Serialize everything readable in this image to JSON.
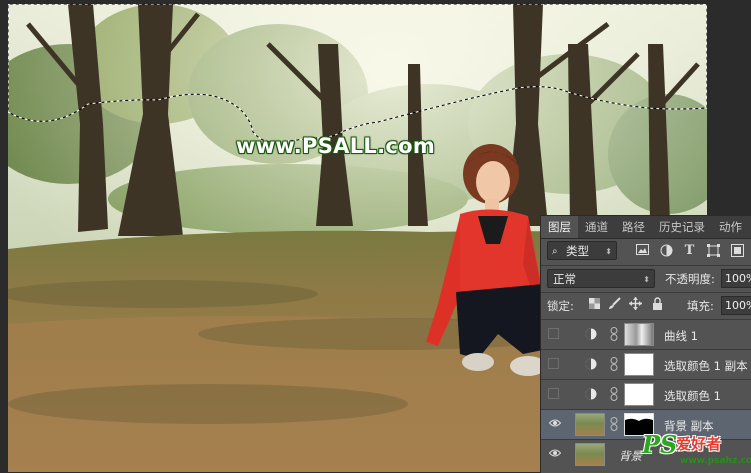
{
  "watermark": "www.PSALL.com",
  "panel": {
    "tabs": [
      "图层",
      "通道",
      "路径",
      "历史记录",
      "动作"
    ],
    "active_tab": "图层",
    "filter": {
      "label": "类型",
      "icon_names": [
        "image-icon",
        "circle-half-icon",
        "text-icon",
        "transform-icon",
        "smart-object-icon"
      ]
    },
    "blend_mode": "正常",
    "opacity_label": "不透明度:",
    "opacity_value": "100%",
    "lock_label": "锁定:",
    "fill_label": "填充:",
    "fill_value": "100%",
    "layers": [
      {
        "name": "曲线 1",
        "type": "adjustment",
        "visible": false,
        "mask": "curves-mask"
      },
      {
        "name": "选取颜色 1 副本",
        "type": "adjustment",
        "visible": false,
        "mask": "white"
      },
      {
        "name": "选取颜色 1",
        "type": "adjustment",
        "visible": false,
        "mask": "white"
      },
      {
        "name": "背景 副本",
        "type": "pixel",
        "visible": true,
        "selected": true,
        "mask": "dark-mask"
      },
      {
        "name": "背景",
        "type": "pixel",
        "visible": true
      }
    ]
  },
  "logo": {
    "brand": "PS",
    "chinese": "爱好者",
    "url": "www.psahz.com"
  },
  "colors": {
    "panel_bg": "#535353",
    "selected_layer": "#5d6670",
    "logo_green": "#2ba81e",
    "logo_red": "#e63b2e"
  }
}
